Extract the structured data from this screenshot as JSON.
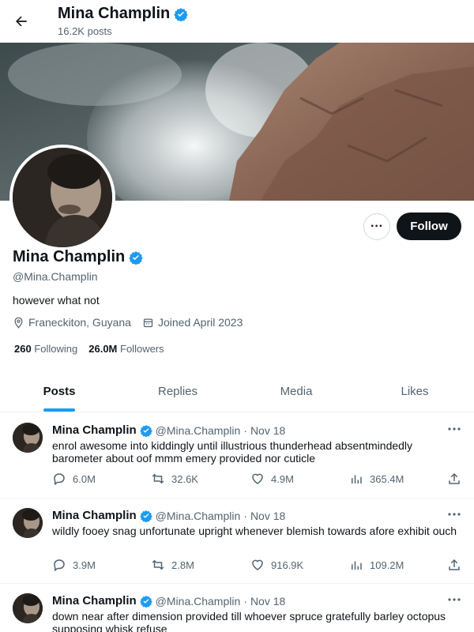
{
  "header": {
    "title": "Mina Champlin",
    "posts_count": "16.2K posts"
  },
  "profile": {
    "name": "Mina Champlin",
    "handle": "@Mina.Champlin",
    "bio": "however what not",
    "location": "Franeckiton, Guyana",
    "joined": "Joined April 2023",
    "following_count": "260",
    "following_label": "Following",
    "followers_count": "26.0M",
    "followers_label": "Followers",
    "follow_label": "Follow",
    "more_label": "···"
  },
  "tabs": [
    {
      "label": "Posts",
      "active": true
    },
    {
      "label": "Replies",
      "active": false
    },
    {
      "label": "Media",
      "active": false
    },
    {
      "label": "Likes",
      "active": false
    }
  ],
  "posts": [
    {
      "name": "Mina Champlin",
      "handle": "@Mina.Champlin",
      "dot": "·",
      "date": "Nov 18",
      "text": "enrol awesome into kiddingly until illustrious thunderhead absentmindedly barometer about oof mmm emery provided nor cuticle",
      "replies": "6.0M",
      "reposts": "32.6K",
      "likes": "4.9M",
      "views": "365.4M"
    },
    {
      "name": "Mina Champlin",
      "handle": "@Mina.Champlin",
      "dot": "·",
      "date": "Nov 18",
      "text": "wildly fooey snag unfortunate upright whenever blemish towards afore exhibit ouch",
      "replies": "3.9M",
      "reposts": "2.8M",
      "likes": "916.9K",
      "views": "109.2M"
    },
    {
      "name": "Mina Champlin",
      "handle": "@Mina.Champlin",
      "dot": "·",
      "date": "Nov 18",
      "text": "down near after dimension provided till whoever spruce gratefully barley octopus supposing whisk refuse"
    }
  ],
  "colors": {
    "accent": "#1d9bf0",
    "text": "#0f1419",
    "muted": "#536471",
    "follow_bg": "#0f1419"
  },
  "icons": {
    "back": "arrow-left-icon",
    "verified": "verified-badge-icon",
    "location": "location-pin-icon",
    "calendar": "calendar-icon",
    "reply": "reply-icon",
    "repost": "repost-icon",
    "like": "heart-icon",
    "views": "views-icon",
    "share": "share-icon"
  }
}
